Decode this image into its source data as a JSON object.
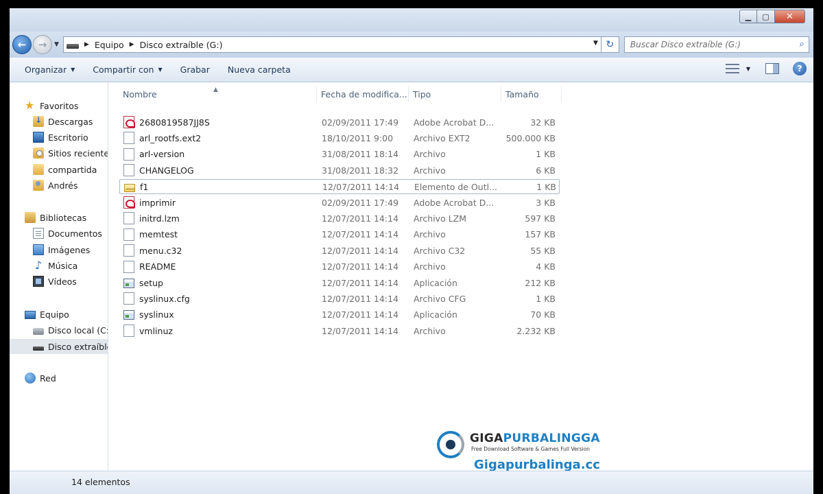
{
  "address": {
    "crumbs": [
      "Equipo",
      "Disco extraíble (G:)"
    ],
    "search_placeholder": "Buscar Disco extraíble (G:)"
  },
  "toolbar": {
    "organize": "Organizar",
    "share": "Compartir con",
    "burn": "Grabar",
    "new_folder": "Nueva carpeta"
  },
  "nav": {
    "favorites": "Favoritos",
    "downloads": "Descargas",
    "desktop": "Escritorio",
    "recent": "Sitios recientes",
    "shared": "compartida",
    "user": "Andrés",
    "libraries": "Bibliotecas",
    "documents": "Documentos",
    "images": "Imágenes",
    "music": "Música",
    "videos": "Vídeos",
    "computer": "Equipo",
    "local_disk": "Disco local (C:",
    "removable": "Disco extraíble",
    "network": "Red"
  },
  "columns": {
    "name": "Nombre",
    "date": "Fecha de modifica...",
    "type": "Tipo",
    "size": "Tamaño"
  },
  "files": [
    {
      "name": "2680819587JJ8S",
      "date": "02/09/2011 17:49",
      "type": "Adobe Acrobat D...",
      "size": "32 KB",
      "icon": "pdf-file-icon"
    },
    {
      "name": "arl_rootfs.ext2",
      "date": "18/10/2011 9:00",
      "type": "Archivo EXT2",
      "size": "500.000 KB",
      "icon": "file-icon"
    },
    {
      "name": "arl-version",
      "date": "31/08/2011 18:14",
      "type": "Archivo",
      "size": "1 KB",
      "icon": "file-icon"
    },
    {
      "name": "CHANGELOG",
      "date": "31/08/2011 18:32",
      "type": "Archivo",
      "size": "6 KB",
      "icon": "file-icon"
    },
    {
      "name": "f1",
      "date": "12/07/2011 14:14",
      "type": "Elemento de Outl...",
      "size": "1 KB",
      "icon": "mail-file-icon"
    },
    {
      "name": "imprimir",
      "date": "02/09/2011 17:49",
      "type": "Adobe Acrobat D...",
      "size": "3 KB",
      "icon": "pdf-file-icon"
    },
    {
      "name": "initrd.lzm",
      "date": "12/07/2011 14:14",
      "type": "Archivo LZM",
      "size": "597 KB",
      "icon": "file-icon"
    },
    {
      "name": "memtest",
      "date": "12/07/2011 14:14",
      "type": "Archivo",
      "size": "157 KB",
      "icon": "file-icon"
    },
    {
      "name": "menu.c32",
      "date": "12/07/2011 14:14",
      "type": "Archivo C32",
      "size": "55 KB",
      "icon": "file-icon"
    },
    {
      "name": "README",
      "date": "12/07/2011 14:14",
      "type": "Archivo",
      "size": "4 KB",
      "icon": "file-icon"
    },
    {
      "name": "setup",
      "date": "12/07/2011 14:14",
      "type": "Aplicación",
      "size": "212 KB",
      "icon": "application-icon"
    },
    {
      "name": "syslinux.cfg",
      "date": "12/07/2011 14:14",
      "type": "Archivo CFG",
      "size": "1 KB",
      "icon": "file-icon"
    },
    {
      "name": "syslinux",
      "date": "12/07/2011 14:14",
      "type": "Aplicación",
      "size": "70 KB",
      "icon": "application-icon"
    },
    {
      "name": "vmlinuz",
      "date": "12/07/2011 14:14",
      "type": "Archivo",
      "size": "2.232 KB",
      "icon": "file-icon"
    }
  ],
  "status": {
    "count": "14 elementos"
  },
  "watermark": {
    "brand_a": "GIGA",
    "brand_b": "PURBALINGGA",
    "tagline": "Free Download Software & Games Full Version",
    "url": "Gigapurbalinga.cc"
  }
}
